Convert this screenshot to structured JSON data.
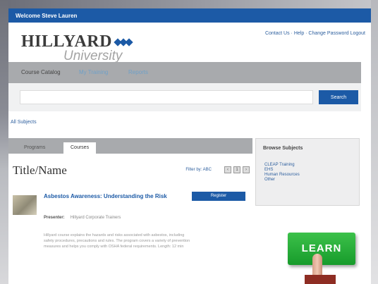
{
  "welcome": {
    "text": "Welcome Steve Lauren"
  },
  "logo": {
    "top": "HILLYARD",
    "bottom": "University"
  },
  "top_links": {
    "text": "Contact Us · Help · Change Password Logout"
  },
  "tabs": [
    {
      "label": "Course Catalog"
    },
    {
      "label": "My Training"
    },
    {
      "label": "Reports"
    }
  ],
  "search": {
    "value": "",
    "button": "Search"
  },
  "all_subjects": "All Subjects",
  "content_tabs": [
    {
      "label": "Programs"
    },
    {
      "label": "Courses"
    }
  ],
  "list": {
    "title": "Title/Name",
    "filter": "Filter by: ABC",
    "pager": {
      "prev": "‹",
      "page": "1",
      "next": "›"
    }
  },
  "course": {
    "title": "Asbestos Awareness: Understanding the Risk",
    "register": "Register",
    "presenter_label": "Presenter:",
    "presenter": "Hillyard Corporate Trainers",
    "description": "Hillyard course explains the hazards and risks associated with asbestos, including safety procedures, precautions and rules. The program covers a variety of prevention measures and helps you comply with OSHA federal requirements. Length: 12 min"
  },
  "browse": {
    "title": "Browse Subjects",
    "items": [
      "CLEAP Training",
      "EHS",
      "Human Resources",
      "Other"
    ]
  },
  "learn_key": "LEARN",
  "colors": {
    "brand": "#1c5aa6",
    "tab_bar": "#a8aaad",
    "learn": "#1f9e35"
  }
}
